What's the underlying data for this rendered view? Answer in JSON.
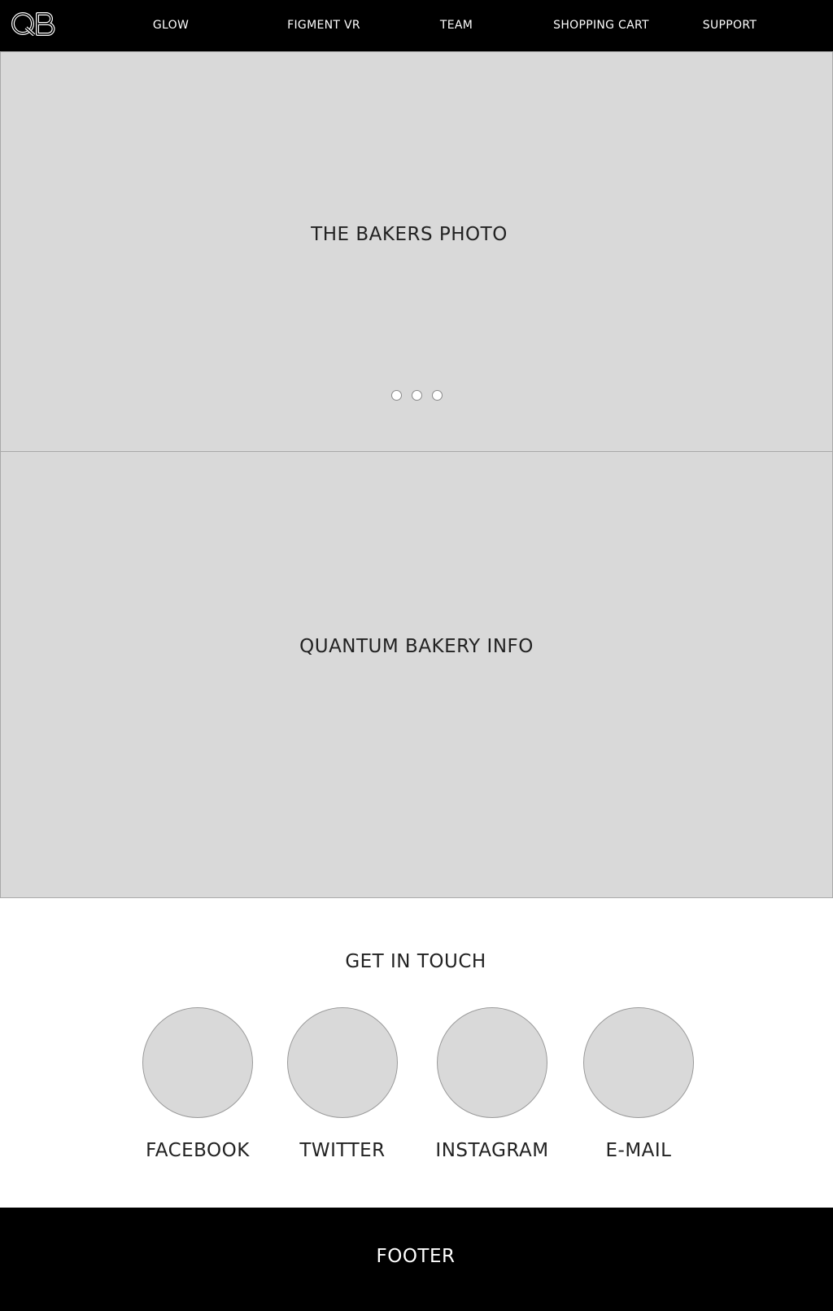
{
  "nav": {
    "logo_text": "QB",
    "items": [
      {
        "label": "GLOW"
      },
      {
        "label": "FIGMENT VR"
      },
      {
        "label": "TEAM"
      },
      {
        "label": "SHOPPING CART"
      },
      {
        "label": "SUPPORT"
      }
    ]
  },
  "hero": {
    "title": "THE BAKERS PHOTO",
    "carousel_dots": 3,
    "active_dot_index": null
  },
  "info": {
    "title": "QUANTUM BAKERY INFO"
  },
  "contact": {
    "title": "GET IN TOUCH",
    "links": [
      {
        "label": "FACEBOOK"
      },
      {
        "label": "TWITTER"
      },
      {
        "label": "INSTAGRAM"
      },
      {
        "label": "E-MAIL"
      }
    ]
  },
  "footer": {
    "label": "FOOTER"
  },
  "colors": {
    "nav_bg": "#000000",
    "placeholder_bg": "#d9d9d9",
    "placeholder_border": "#a9a9a9",
    "text_dark": "#222222",
    "text_light": "#ffffff"
  }
}
